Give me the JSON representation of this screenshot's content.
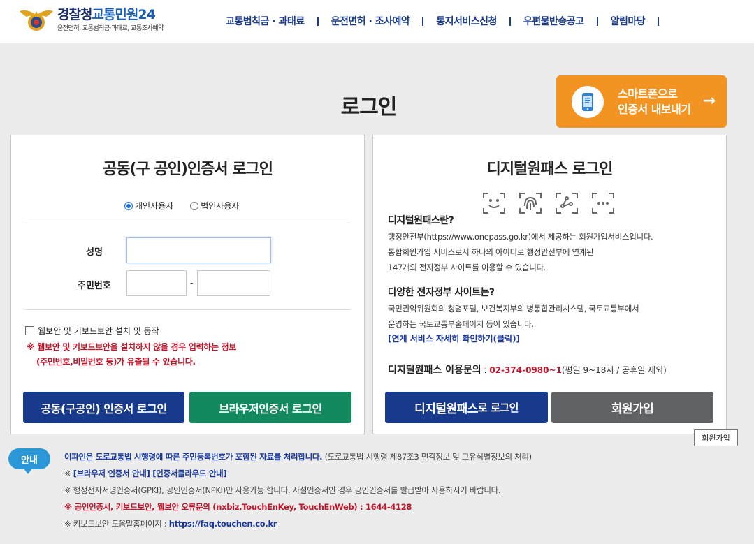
{
  "header": {
    "logo_main_a": "경찰청",
    "logo_main_b": "교통민원24",
    "logo_sub": "운전면허, 교통범칙금·과태료, 교통조사예약",
    "nav": [
      {
        "label": "교통범칙금 · 과태료"
      },
      {
        "label": "운전면허 · 조사예약"
      },
      {
        "label": "통지서비스신청"
      },
      {
        "label": "우편물반송공고"
      },
      {
        "label": "알림마당"
      }
    ]
  },
  "page_title": "로그인",
  "smart_button": {
    "line1": "스마트폰으로",
    "line2": "인증서 내보내기",
    "arrow": "→"
  },
  "left_panel": {
    "title": "공동(구 공인)인증서 로그인",
    "radio_personal": "개인사용자",
    "radio_corporate": "법인사용자",
    "name_label": "성명",
    "rrn_label": "주민번호",
    "rrn_dash": "-",
    "name_value": "",
    "rrn_front_value": "",
    "rrn_back_value": "",
    "checkbox_label": "웹보안 및 키보드보안 설치 및 동작",
    "warning_line1": "※ 웹보안 및 키보드보안을 설치하지 않을 경우 입력하는 정보",
    "warning_line2": "(주민번호,비밀번호 등)가 유출될 수 있습니다.",
    "btn_cert_login": "공동(구공인) 인증서 로그인",
    "btn_browser_login": "브라우저인증서 로그인"
  },
  "right_panel": {
    "title": "디지털원패스 로그인",
    "q1": "디지털원패스란?",
    "q1_line1": "행정안전부(https://www.onepass.go.kr)에서 제공하는 회원가입서비스입니다.",
    "q1_line2": "통합회원가입 서비스로서 하나의 아이디로 행정안전부에 연계된",
    "q1_line3": "147개의 전자정부 사이트를 이용할 수 있습니다.",
    "q2": "다양한 전자정부 사이트는?",
    "q2_line1": "국민권익위원회의 청렴포털, 보건복지부의 병통합관리시스템, 국토교통부에서",
    "q2_line2": "운영하는 국토교통부홈페이지 등이 있습니다.",
    "link": "[연계 서비스 자세히 확인하기(클릭)]",
    "contact_label": "디지털원패스 이용문의",
    "contact_colon": " : ",
    "contact_tel": "02-374-0980~1",
    "contact_hours": "(평일 9~18시 / 공휴일 제외)",
    "btn_onepass_a": "디지털원패스",
    "btn_onepass_b": " 로 로그인",
    "btn_signup": "회원가입"
  },
  "tooltip": "회원가입",
  "notice": {
    "badge": "안내",
    "line1_bold": "이파인은 도로교통법 시행령에 따른 주민등록번호가 포함된 자료를 처리합니다.",
    "line1_rest": " (도로교통법 시행령 제87조3 민감정보 및 고유식별정보의 처리)",
    "line2_prefix": "※ ",
    "line2_link1": "[브라우저 인증서 안내]",
    "line2_link2": " [인증서클라우드 안내]",
    "line3": "※ 행정전자서명인증서(GPKI), 공인인증서(NPKI)만 사용가능 합니다. 사설인증서인 경우 공인인증서를 발급받아 사용하시기 바랍니다.",
    "line4": "※ 공인인증서, 키보드보안, 웹보안 오류문의 (nxbiz,TouchEnKey, TouchEnWeb) : 1644-4128",
    "line5_prefix": "※ 키보드보안 도움말홈페이지 : ",
    "line5_url": "https://faq.touchen.co.kr"
  },
  "colors": {
    "navy": "#183a8c",
    "green": "#128a5e",
    "orange": "#f39322",
    "gray": "#606266",
    "warn_red": "#c0152a",
    "link_blue": "#1a3aa0"
  }
}
